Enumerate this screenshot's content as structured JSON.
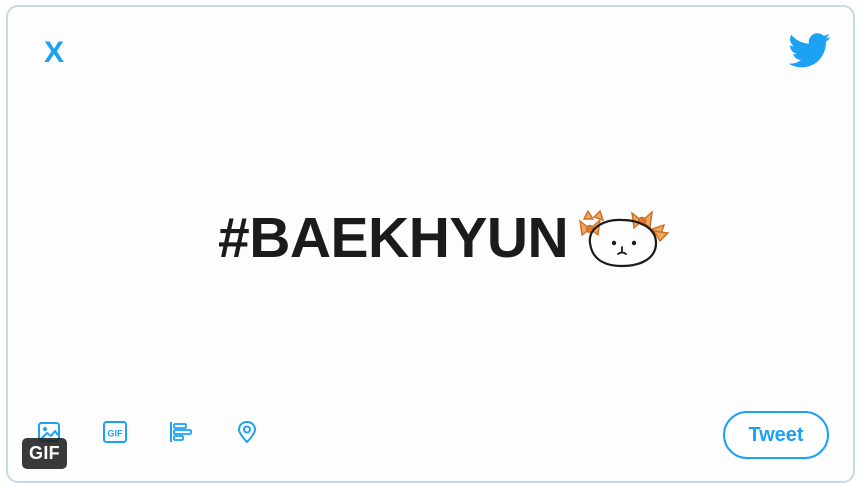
{
  "compose": {
    "close_label": "X",
    "headline_text": "#BAEKHYUN",
    "tweet_button_label": "Tweet"
  },
  "toolbar": {
    "icons": [
      "image-icon",
      "gif-icon",
      "poll-icon",
      "location-icon"
    ],
    "gif_icon_text": "GIF"
  },
  "overlay": {
    "gif_badge": "GIF"
  },
  "colors": {
    "accent": "#1da1f2",
    "headline": "#1b1b1b",
    "card_border": "#c7dbe6",
    "doodle_orange": "#e8893a"
  }
}
